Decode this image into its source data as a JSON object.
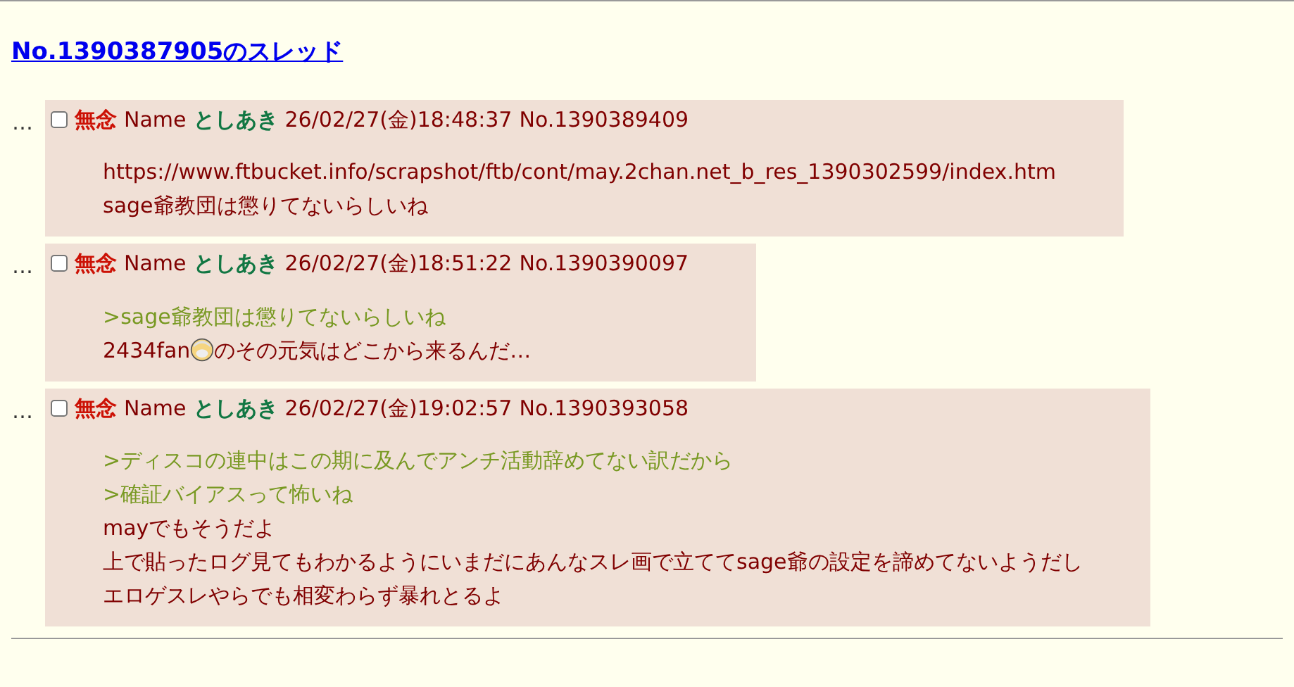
{
  "thread_title": "No.1390387905のスレッド",
  "posts": [
    {
      "marker": "…",
      "checked": false,
      "subject": "無念",
      "name_label": "Name",
      "name": "としあき",
      "date": "26/02/27(金)18:48:37",
      "number": "No.1390389409",
      "lines": [
        {
          "kind": "text",
          "text": "https://www.ftbucket.info/scrapshot/ftb/cont/may.2chan.net_b_res_1390302599/index.htm"
        },
        {
          "kind": "text",
          "text": "sage爺教団は懲りてないらしいね"
        }
      ]
    },
    {
      "marker": "…",
      "checked": false,
      "subject": "無念",
      "name_label": "Name",
      "name": "としあき",
      "date": "26/02/27(金)18:51:22",
      "number": "No.1390390097",
      "lines": [
        {
          "kind": "quote",
          "text": ">sage爺教団は懲りてないらしいね"
        },
        {
          "kind": "emoji",
          "before": "2434fan",
          "after": "のその元気はどこから来るんだ…"
        }
      ]
    },
    {
      "marker": "…",
      "checked": false,
      "subject": "無念",
      "name_label": "Name",
      "name": "としあき",
      "date": "26/02/27(金)19:02:57",
      "number": "No.1390393058",
      "lines": [
        {
          "kind": "quote",
          "text": ">ディスコの連中はこの期に及んでアンチ活動辞めてない訳だから"
        },
        {
          "kind": "quote",
          "text": ">確証バイアスって怖いね"
        },
        {
          "kind": "text",
          "text": "mayでもそうだよ"
        },
        {
          "kind": "text",
          "text": "上で貼ったログ見てもわかるようにいまだにあんなスレ画で立ててsage爺の設定を諦めてないようだし"
        },
        {
          "kind": "text",
          "text": "エロゲスレやらでも相変わらず暴れとるよ"
        }
      ]
    }
  ]
}
